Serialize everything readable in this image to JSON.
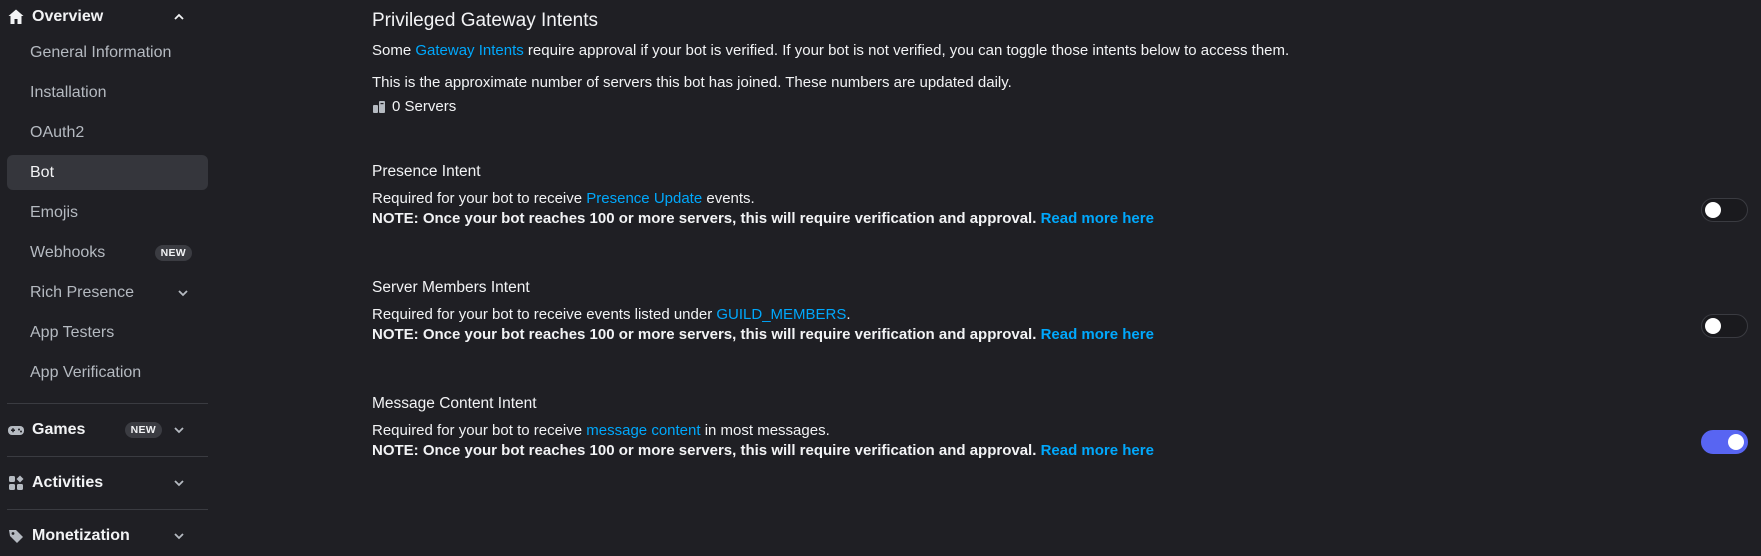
{
  "sidebar": {
    "overview_label": "Overview",
    "items": [
      {
        "label": "General Information"
      },
      {
        "label": "Installation"
      },
      {
        "label": "OAuth2"
      },
      {
        "label": "Bot"
      },
      {
        "label": "Emojis"
      },
      {
        "label": "Webhooks",
        "badge": "NEW"
      },
      {
        "label": "Rich Presence"
      },
      {
        "label": "App Testers"
      },
      {
        "label": "App Verification"
      }
    ],
    "games_label": "Games",
    "games_badge": "NEW",
    "activities_label": "Activities",
    "monetization_label": "Monetization"
  },
  "main": {
    "title": "Privileged Gateway Intents",
    "intro_prefix": "Some ",
    "intro_link": "Gateway Intents",
    "intro_suffix": " require approval if your bot is verified. If your bot is not verified, you can toggle those intents below to access them.",
    "approx_text": "This is the approximate number of servers this bot has joined. These numbers are updated daily.",
    "servers_text": "0 Servers",
    "note_text": "NOTE: Once your bot reaches 100 or more servers, this will require verification and approval.",
    "read_more": "Read more here",
    "intents": [
      {
        "title": "Presence Intent",
        "desc_prefix": "Required for your bot to receive ",
        "desc_link": "Presence Update",
        "desc_suffix": " events.",
        "enabled": false
      },
      {
        "title": "Server Members Intent",
        "desc_prefix": "Required for your bot to receive events listed under ",
        "desc_link": "GUILD_MEMBERS",
        "desc_suffix": ".",
        "enabled": false
      },
      {
        "title": "Message Content Intent",
        "desc_prefix": "Required for your bot to receive ",
        "desc_link": "message content",
        "desc_suffix": " in most messages.",
        "enabled": true
      }
    ]
  },
  "colors": {
    "background": "#1f1f24",
    "link": "#00a8fc",
    "toggle_on": "#5865f2",
    "active_item": "#35363c"
  },
  "icons": [
    "home-icon",
    "chevron-up-icon",
    "chevron-down-icon",
    "gamepad-icon",
    "activities-icon",
    "monetization-icon",
    "servers-icon"
  ]
}
